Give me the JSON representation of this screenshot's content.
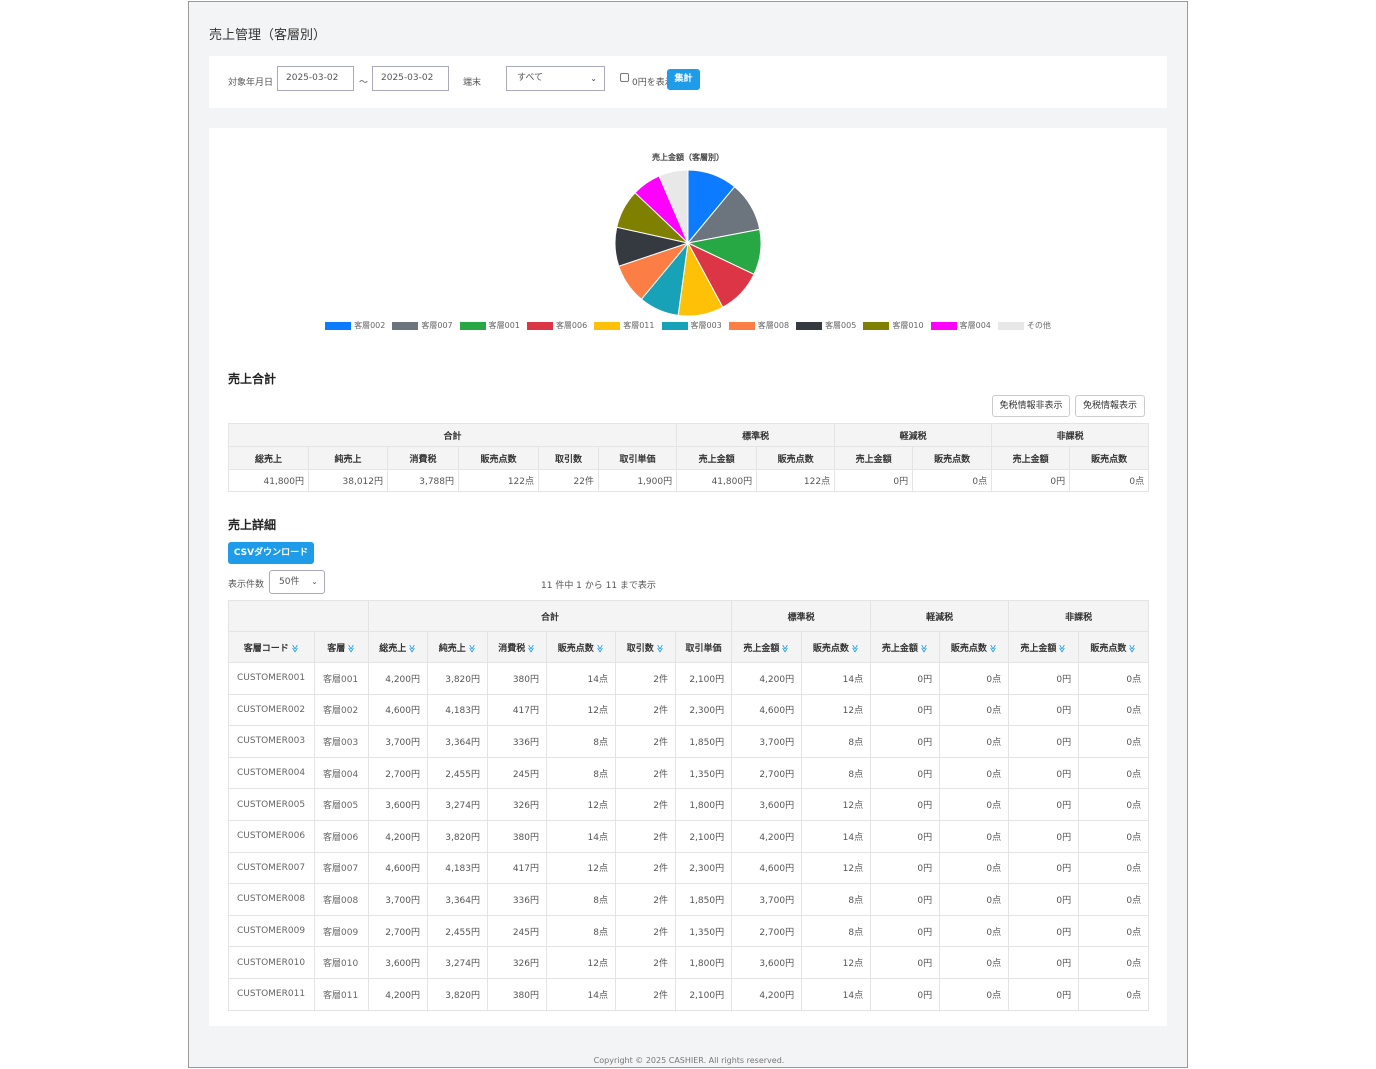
{
  "page": {
    "title": "売上管理（客層別）",
    "footer": "Copyright © 2025 CASHIER. All rights reserved."
  },
  "filter": {
    "date_label": "対象年月日",
    "date_from": "2025-03-02",
    "date_sep": "〜",
    "date_to": "2025-03-02",
    "terminal_label": "端末",
    "terminal_value": "すべて",
    "zero_label": "0円を表示",
    "zero_checked": false,
    "submit_label": "集計"
  },
  "chart_data": {
    "type": "pie",
    "title": "売上金額（客層別）",
    "slices": [
      {
        "label": "客層002",
        "value": 4600,
        "color": "#0d7bff"
      },
      {
        "label": "客層007",
        "value": 4600,
        "color": "#6c757d"
      },
      {
        "label": "客層001",
        "value": 4200,
        "color": "#28a745"
      },
      {
        "label": "客層006",
        "value": 4200,
        "color": "#dc3545"
      },
      {
        "label": "客層011",
        "value": 4200,
        "color": "#ffc107"
      },
      {
        "label": "客層003",
        "value": 3700,
        "color": "#17a2b8"
      },
      {
        "label": "客層008",
        "value": 3700,
        "color": "#fd7e45"
      },
      {
        "label": "客層005",
        "value": 3600,
        "color": "#343a40"
      },
      {
        "label": "客層010",
        "value": 3600,
        "color": "#808000"
      },
      {
        "label": "客層004",
        "value": 2700,
        "color": "#ff00ff"
      },
      {
        "label": "その他",
        "value": 2700,
        "color": "#e8e8e8"
      }
    ],
    "legend_position": "bottom"
  },
  "summary": {
    "title": "売上合計",
    "btn_hide_taxfree": "免税情報非表示",
    "btn_show_taxfree": "免税情報表示",
    "groups": [
      "合計",
      "標準税",
      "軽減税",
      "非課税"
    ],
    "columns": [
      "総売上",
      "純売上",
      "消費税",
      "販売点数",
      "取引数",
      "取引単価",
      "売上金額",
      "販売点数",
      "売上金額",
      "販売点数",
      "売上金額",
      "販売点数"
    ],
    "row": [
      "41,800円",
      "38,012円",
      "3,788円",
      "122点",
      "22件",
      "1,900円",
      "41,800円",
      "122点",
      "0円",
      "0点",
      "0円",
      "0点"
    ]
  },
  "detail": {
    "title": "売上詳細",
    "csv_label": "CSVダウンロード",
    "per_page_label": "表示件数",
    "per_page_value": "50件",
    "info": "11 件中 1 から 11 まで表示",
    "groups": [
      "合計",
      "標準税",
      "軽減税",
      "非課税"
    ],
    "columns": [
      "客層コード",
      "客層",
      "総売上",
      "純売上",
      "消費税",
      "販売点数",
      "取引数",
      "取引単価",
      "売上金額",
      "販売点数",
      "売上金額",
      "販売点数",
      "売上金額",
      "販売点数"
    ],
    "sortable": [
      true,
      true,
      true,
      true,
      true,
      true,
      true,
      false,
      true,
      true,
      true,
      true,
      true,
      true
    ],
    "rows": [
      [
        "CUSTOMER001",
        "客層001",
        "4,200円",
        "3,820円",
        "380円",
        "14点",
        "2件",
        "2,100円",
        "4,200円",
        "14点",
        "0円",
        "0点",
        "0円",
        "0点"
      ],
      [
        "CUSTOMER002",
        "客層002",
        "4,600円",
        "4,183円",
        "417円",
        "12点",
        "2件",
        "2,300円",
        "4,600円",
        "12点",
        "0円",
        "0点",
        "0円",
        "0点"
      ],
      [
        "CUSTOMER003",
        "客層003",
        "3,700円",
        "3,364円",
        "336円",
        "8点",
        "2件",
        "1,850円",
        "3,700円",
        "8点",
        "0円",
        "0点",
        "0円",
        "0点"
      ],
      [
        "CUSTOMER004",
        "客層004",
        "2,700円",
        "2,455円",
        "245円",
        "8点",
        "2件",
        "1,350円",
        "2,700円",
        "8点",
        "0円",
        "0点",
        "0円",
        "0点"
      ],
      [
        "CUSTOMER005",
        "客層005",
        "3,600円",
        "3,274円",
        "326円",
        "12点",
        "2件",
        "1,800円",
        "3,600円",
        "12点",
        "0円",
        "0点",
        "0円",
        "0点"
      ],
      [
        "CUSTOMER006",
        "客層006",
        "4,200円",
        "3,820円",
        "380円",
        "14点",
        "2件",
        "2,100円",
        "4,200円",
        "14点",
        "0円",
        "0点",
        "0円",
        "0点"
      ],
      [
        "CUSTOMER007",
        "客層007",
        "4,600円",
        "4,183円",
        "417円",
        "12点",
        "2件",
        "2,300円",
        "4,600円",
        "12点",
        "0円",
        "0点",
        "0円",
        "0点"
      ],
      [
        "CUSTOMER008",
        "客層008",
        "3,700円",
        "3,364円",
        "336円",
        "8点",
        "2件",
        "1,850円",
        "3,700円",
        "8点",
        "0円",
        "0点",
        "0円",
        "0点"
      ],
      [
        "CUSTOMER009",
        "客層009",
        "2,700円",
        "2,455円",
        "245円",
        "8点",
        "2件",
        "1,350円",
        "2,700円",
        "8点",
        "0円",
        "0点",
        "0円",
        "0点"
      ],
      [
        "CUSTOMER010",
        "客層010",
        "3,600円",
        "3,274円",
        "326円",
        "12点",
        "2件",
        "1,800円",
        "3,600円",
        "12点",
        "0円",
        "0点",
        "0円",
        "0点"
      ],
      [
        "CUSTOMER011",
        "客層011",
        "4,200円",
        "3,820円",
        "380円",
        "14点",
        "2件",
        "2,100円",
        "4,200円",
        "14点",
        "0円",
        "0点",
        "0円",
        "0点"
      ]
    ]
  }
}
